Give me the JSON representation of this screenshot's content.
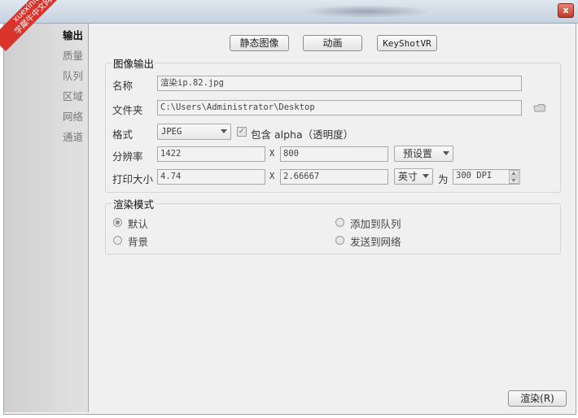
{
  "watermark": {
    "line1": "xuexiniu",
    "line2": "学犀牛中文网"
  },
  "window": {
    "close_glyph": "x"
  },
  "sidebar": {
    "items": [
      {
        "label": "输出",
        "active": true
      },
      {
        "label": "质量",
        "active": false
      },
      {
        "label": "队列",
        "active": false
      },
      {
        "label": "区域",
        "active": false
      },
      {
        "label": "网络",
        "active": false
      },
      {
        "label": "通道",
        "active": false
      }
    ]
  },
  "toolbar": {
    "still_label": "静态图像",
    "animation_label": "动画",
    "keyshotvr_label": "KeyShotVR"
  },
  "image_output": {
    "title": "图像输出",
    "name_label": "名称",
    "name_value": "渲染ip.82.jpg",
    "folder_label": "文件夹",
    "folder_value": "C:\\Users\\Administrator\\Desktop",
    "format_label": "格式",
    "format_value": "JPEG",
    "alpha_checked": true,
    "alpha_label": "包含 alpha（透明度）",
    "resolution_label": "分辨率",
    "width_value": "1422",
    "x_sep": "X",
    "height_value": "800",
    "preset_label": "预设置",
    "print_label": "打印大小",
    "print_width": "4.74",
    "print_height": "2.66667",
    "unit_value": "英寸",
    "for_label": "为",
    "dpi_value": "300 DPI"
  },
  "render_mode": {
    "title": "渲染模式",
    "options": [
      {
        "label": "默认",
        "checked": true
      },
      {
        "label": "添加到队列",
        "checked": false
      },
      {
        "label": "背景",
        "checked": false
      },
      {
        "label": "发送到网络",
        "checked": false
      }
    ]
  },
  "footer": {
    "render_button": "渲染(R)"
  },
  "colors": {
    "ribbon": "#d9342b",
    "close": "#c0392b"
  },
  "icons": {
    "folder": "folder-icon",
    "close": "close-icon",
    "dropdown": "chevron-down-icon"
  }
}
